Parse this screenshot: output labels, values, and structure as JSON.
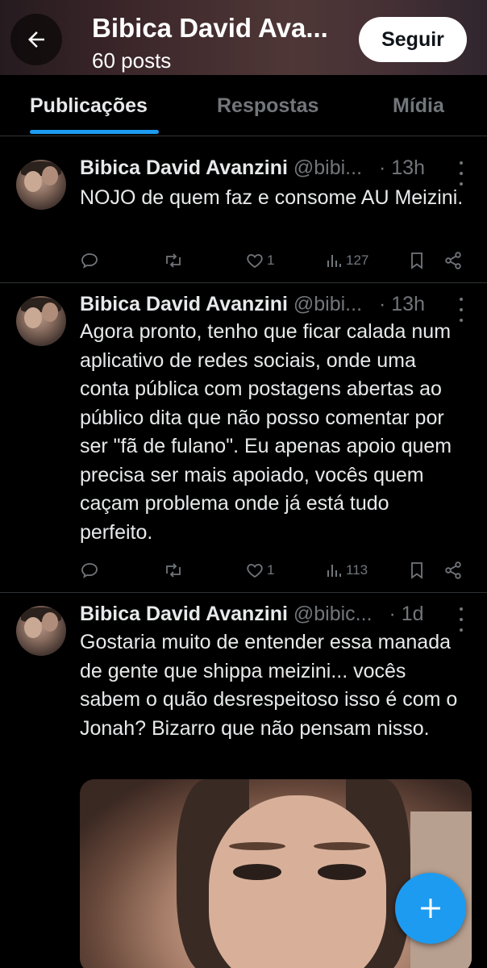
{
  "header": {
    "title": "Bibica David Ava...",
    "posts_count": "60 posts",
    "follow_label": "Seguir"
  },
  "tabs": [
    {
      "label": "Publicações",
      "active": true
    },
    {
      "label": "Respostas",
      "active": false
    },
    {
      "label": "Mídia",
      "active": false
    }
  ],
  "posts": [
    {
      "name": "Bibica David Avanzini",
      "handle": "@bibi...",
      "time": "· 13h",
      "text": "NOJO de quem faz e consome AU Meizini.",
      "likes": "1",
      "views": "127"
    },
    {
      "name": "Bibica David Avanzini",
      "handle": "@bibi...",
      "time": "· 13h",
      "text": "Agora pronto, tenho que ficar calada num aplicativo de redes sociais, onde uma conta pública com postagens abertas ao público dita que não posso comentar por ser \"fã de fulano\". Eu apenas apoio quem precisa ser mais apoiado, vocês quem caçam problema onde já está tudo perfeito.",
      "likes": "1",
      "views": "113"
    },
    {
      "name": "Bibica David Avanzini",
      "handle": "@bibic...",
      "time": "· 1d",
      "text": "Gostaria muito de entender essa manada de gente que shippa meizini... vocês sabem o quão desrespeitoso isso é com o Jonah? Bizarro que não pensam nisso."
    }
  ],
  "colors": {
    "accent": "#1d9bf0",
    "muted": "#71767b",
    "text": "#e7e9ea",
    "divider": "#2f3336"
  },
  "icons": [
    "back-arrow-icon",
    "reply-icon",
    "retweet-icon",
    "heart-icon",
    "views-icon",
    "bookmark-icon",
    "share-icon",
    "more-icon",
    "plus-icon"
  ]
}
